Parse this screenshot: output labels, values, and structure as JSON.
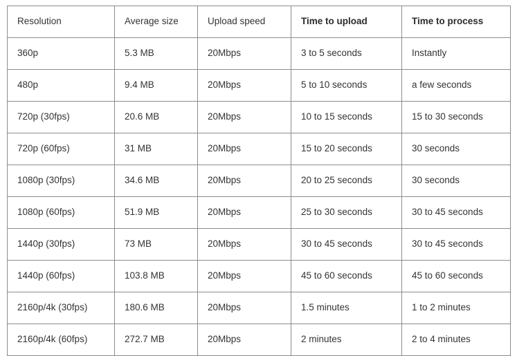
{
  "table": {
    "columns": [
      {
        "key": "resolution",
        "label": "Resolution",
        "bold": false
      },
      {
        "key": "avg_size",
        "label": "Average size",
        "bold": false
      },
      {
        "key": "upload_speed",
        "label": "Upload speed",
        "bold": false
      },
      {
        "key": "time_upload",
        "label": "Time to upload",
        "bold": true
      },
      {
        "key": "time_process",
        "label": "Time to process",
        "bold": true
      }
    ],
    "rows": [
      {
        "resolution": "360p",
        "avg_size": "5.3 MB",
        "upload_speed": "20Mbps",
        "time_upload": "3 to 5 seconds",
        "time_process": "Instantly"
      },
      {
        "resolution": "480p",
        "avg_size": "9.4 MB",
        "upload_speed": "20Mbps",
        "time_upload": "5 to 10 seconds",
        "time_process": "a few seconds"
      },
      {
        "resolution": "720p (30fps)",
        "avg_size": "20.6 MB",
        "upload_speed": "20Mbps",
        "time_upload": "10 to 15 seconds",
        "time_process": "15 to 30 seconds"
      },
      {
        "resolution": "720p (60fps)",
        "avg_size": "31 MB",
        "upload_speed": "20Mbps",
        "time_upload": "15 to 20 seconds",
        "time_process": "30 seconds"
      },
      {
        "resolution": "1080p (30fps)",
        "avg_size": "34.6 MB",
        "upload_speed": "20Mbps",
        "time_upload": "20 to 25 seconds",
        "time_process": "30 seconds"
      },
      {
        "resolution": "1080p (60fps)",
        "avg_size": "51.9 MB",
        "upload_speed": "20Mbps",
        "time_upload": "25 to 30 seconds",
        "time_process": "30 to 45 seconds"
      },
      {
        "resolution": "1440p (30fps)",
        "avg_size": "73 MB",
        "upload_speed": "20Mbps",
        "time_upload": "30 to 45 seconds",
        "time_process": "30 to 45 seconds"
      },
      {
        "resolution": "1440p (60fps)",
        "avg_size": "103.8 MB",
        "upload_speed": "20Mbps",
        "time_upload": "45 to 60 seconds",
        "time_process": "45 to 60 seconds"
      },
      {
        "resolution": "2160p/4k (30fps)",
        "avg_size": "180.6 MB",
        "upload_speed": "20Mbps",
        "time_upload": "1.5 minutes",
        "time_process": "1 to 2 minutes"
      },
      {
        "resolution": "2160p/4k (60fps)",
        "avg_size": "272.7 MB",
        "upload_speed": "20Mbps",
        "time_upload": "2 minutes",
        "time_process": "2 to 4 minutes"
      }
    ]
  },
  "chart_data": {
    "type": "table",
    "title": "",
    "columns": [
      "Resolution",
      "Average size",
      "Upload speed",
      "Time to upload",
      "Time to process"
    ],
    "rows": [
      [
        "360p",
        "5.3 MB",
        "20Mbps",
        "3 to 5 seconds",
        "Instantly"
      ],
      [
        "480p",
        "9.4 MB",
        "20Mbps",
        "5 to 10 seconds",
        "a few seconds"
      ],
      [
        "720p (30fps)",
        "20.6 MB",
        "20Mbps",
        "10 to 15 seconds",
        "15 to 30 seconds"
      ],
      [
        "720p (60fps)",
        "31 MB",
        "20Mbps",
        "15 to 20 seconds",
        "30 seconds"
      ],
      [
        "1080p (30fps)",
        "34.6 MB",
        "20Mbps",
        "20 to 25 seconds",
        "30 seconds"
      ],
      [
        "1080p (60fps)",
        "51.9 MB",
        "20Mbps",
        "25 to 30 seconds",
        "30 to 45 seconds"
      ],
      [
        "1440p (30fps)",
        "73 MB",
        "20Mbps",
        "30 to 45 seconds",
        "30 to 45 seconds"
      ],
      [
        "1440p (60fps)",
        "103.8 MB",
        "20Mbps",
        "45 to 60 seconds",
        "45 to 60 seconds"
      ],
      [
        "2160p/4k (30fps)",
        "180.6 MB",
        "20Mbps",
        "1.5 minutes",
        "1 to 2 minutes"
      ],
      [
        "2160p/4k (60fps)",
        "272.7 MB",
        "20Mbps",
        "2 minutes",
        "2 to 4 minutes"
      ]
    ],
    "bold_header_columns": [
      "Time to upload",
      "Time to process"
    ],
    "border_color": "#8c8c8c",
    "text_color": "#333333",
    "background_color": "#ffffff"
  }
}
